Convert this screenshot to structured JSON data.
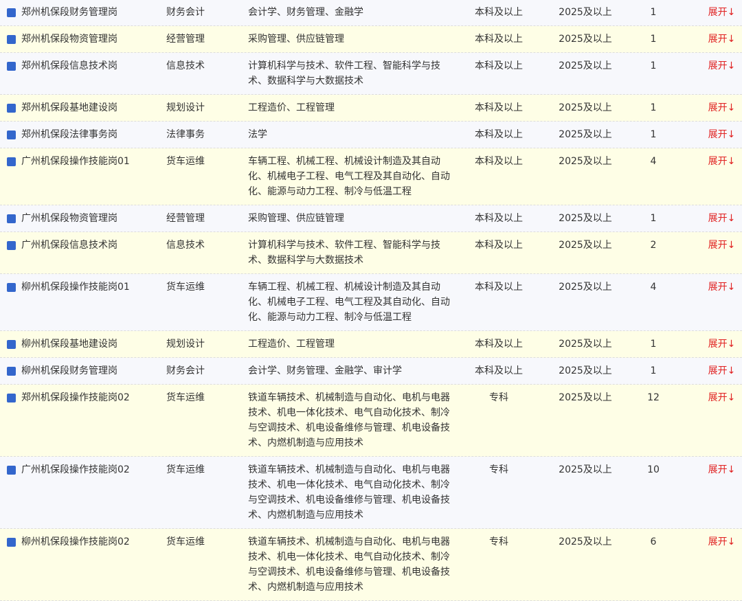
{
  "action_label": "展开↓",
  "colors": {
    "bullet": "#3366cc",
    "action": "#e02020",
    "row_odd": "#f7f8fc",
    "row_even": "#fefee6"
  },
  "rows": [
    {
      "name": "郑州机保段财务管理岗",
      "type": "财务会计",
      "major": "会计学、财务管理、金融学",
      "edu": "本科及以上",
      "year": "2025及以上",
      "count": "1"
    },
    {
      "name": "郑州机保段物资管理岗",
      "type": "经营管理",
      "major": "采购管理、供应链管理",
      "edu": "本科及以上",
      "year": "2025及以上",
      "count": "1"
    },
    {
      "name": "郑州机保段信息技术岗",
      "type": "信息技术",
      "major": "计算机科学与技术、软件工程、智能科学与技术、数据科学与大数据技术",
      "edu": "本科及以上",
      "year": "2025及以上",
      "count": "1"
    },
    {
      "name": "郑州机保段基地建设岗",
      "type": "规划设计",
      "major": "工程造价、工程管理",
      "edu": "本科及以上",
      "year": "2025及以上",
      "count": "1"
    },
    {
      "name": "郑州机保段法律事务岗",
      "type": "法律事务",
      "major": "法学",
      "edu": "本科及以上",
      "year": "2025及以上",
      "count": "1"
    },
    {
      "name": "广州机保段操作技能岗01",
      "type": "货车运维",
      "major": "车辆工程、机械工程、机械设计制造及其自动化、机械电子工程、电气工程及其自动化、自动化、能源与动力工程、制冷与低温工程",
      "edu": "本科及以上",
      "year": "2025及以上",
      "count": "4"
    },
    {
      "name": "广州机保段物资管理岗",
      "type": "经营管理",
      "major": "采购管理、供应链管理",
      "edu": "本科及以上",
      "year": "2025及以上",
      "count": "1"
    },
    {
      "name": "广州机保段信息技术岗",
      "type": "信息技术",
      "major": "计算机科学与技术、软件工程、智能科学与技术、数据科学与大数据技术",
      "edu": "本科及以上",
      "year": "2025及以上",
      "count": "2"
    },
    {
      "name": "柳州机保段操作技能岗01",
      "type": "货车运维",
      "major": "车辆工程、机械工程、机械设计制造及其自动化、机械电子工程、电气工程及其自动化、自动化、能源与动力工程、制冷与低温工程",
      "edu": "本科及以上",
      "year": "2025及以上",
      "count": "4"
    },
    {
      "name": "柳州机保段基地建设岗",
      "type": "规划设计",
      "major": "工程造价、工程管理",
      "edu": "本科及以上",
      "year": "2025及以上",
      "count": "1"
    },
    {
      "name": "柳州机保段财务管理岗",
      "type": "财务会计",
      "major": "会计学、财务管理、金融学、审计学",
      "edu": "本科及以上",
      "year": "2025及以上",
      "count": "1"
    },
    {
      "name": "郑州机保段操作技能岗02",
      "type": "货车运维",
      "major": "铁道车辆技术、机械制造与自动化、电机与电器技术、机电一体化技术、电气自动化技术、制冷与空调技术、机电设备维修与管理、机电设备技术、内燃机制造与应用技术",
      "edu": "专科",
      "year": "2025及以上",
      "count": "12"
    },
    {
      "name": "广州机保段操作技能岗02",
      "type": "货车运维",
      "major": "铁道车辆技术、机械制造与自动化、电机与电器技术、机电一体化技术、电气自动化技术、制冷与空调技术、机电设备维修与管理、机电设备技术、内燃机制造与应用技术",
      "edu": "专科",
      "year": "2025及以上",
      "count": "10"
    },
    {
      "name": "柳州机保段操作技能岗02",
      "type": "货车运维",
      "major": "铁道车辆技术、机械制造与自动化、电机与电器技术、机电一体化技术、电气自动化技术、制冷与空调技术、机电设备维修与管理、机电设备技术、内燃机制造与应用技术",
      "edu": "专科",
      "year": "2025及以上",
      "count": "6"
    }
  ]
}
